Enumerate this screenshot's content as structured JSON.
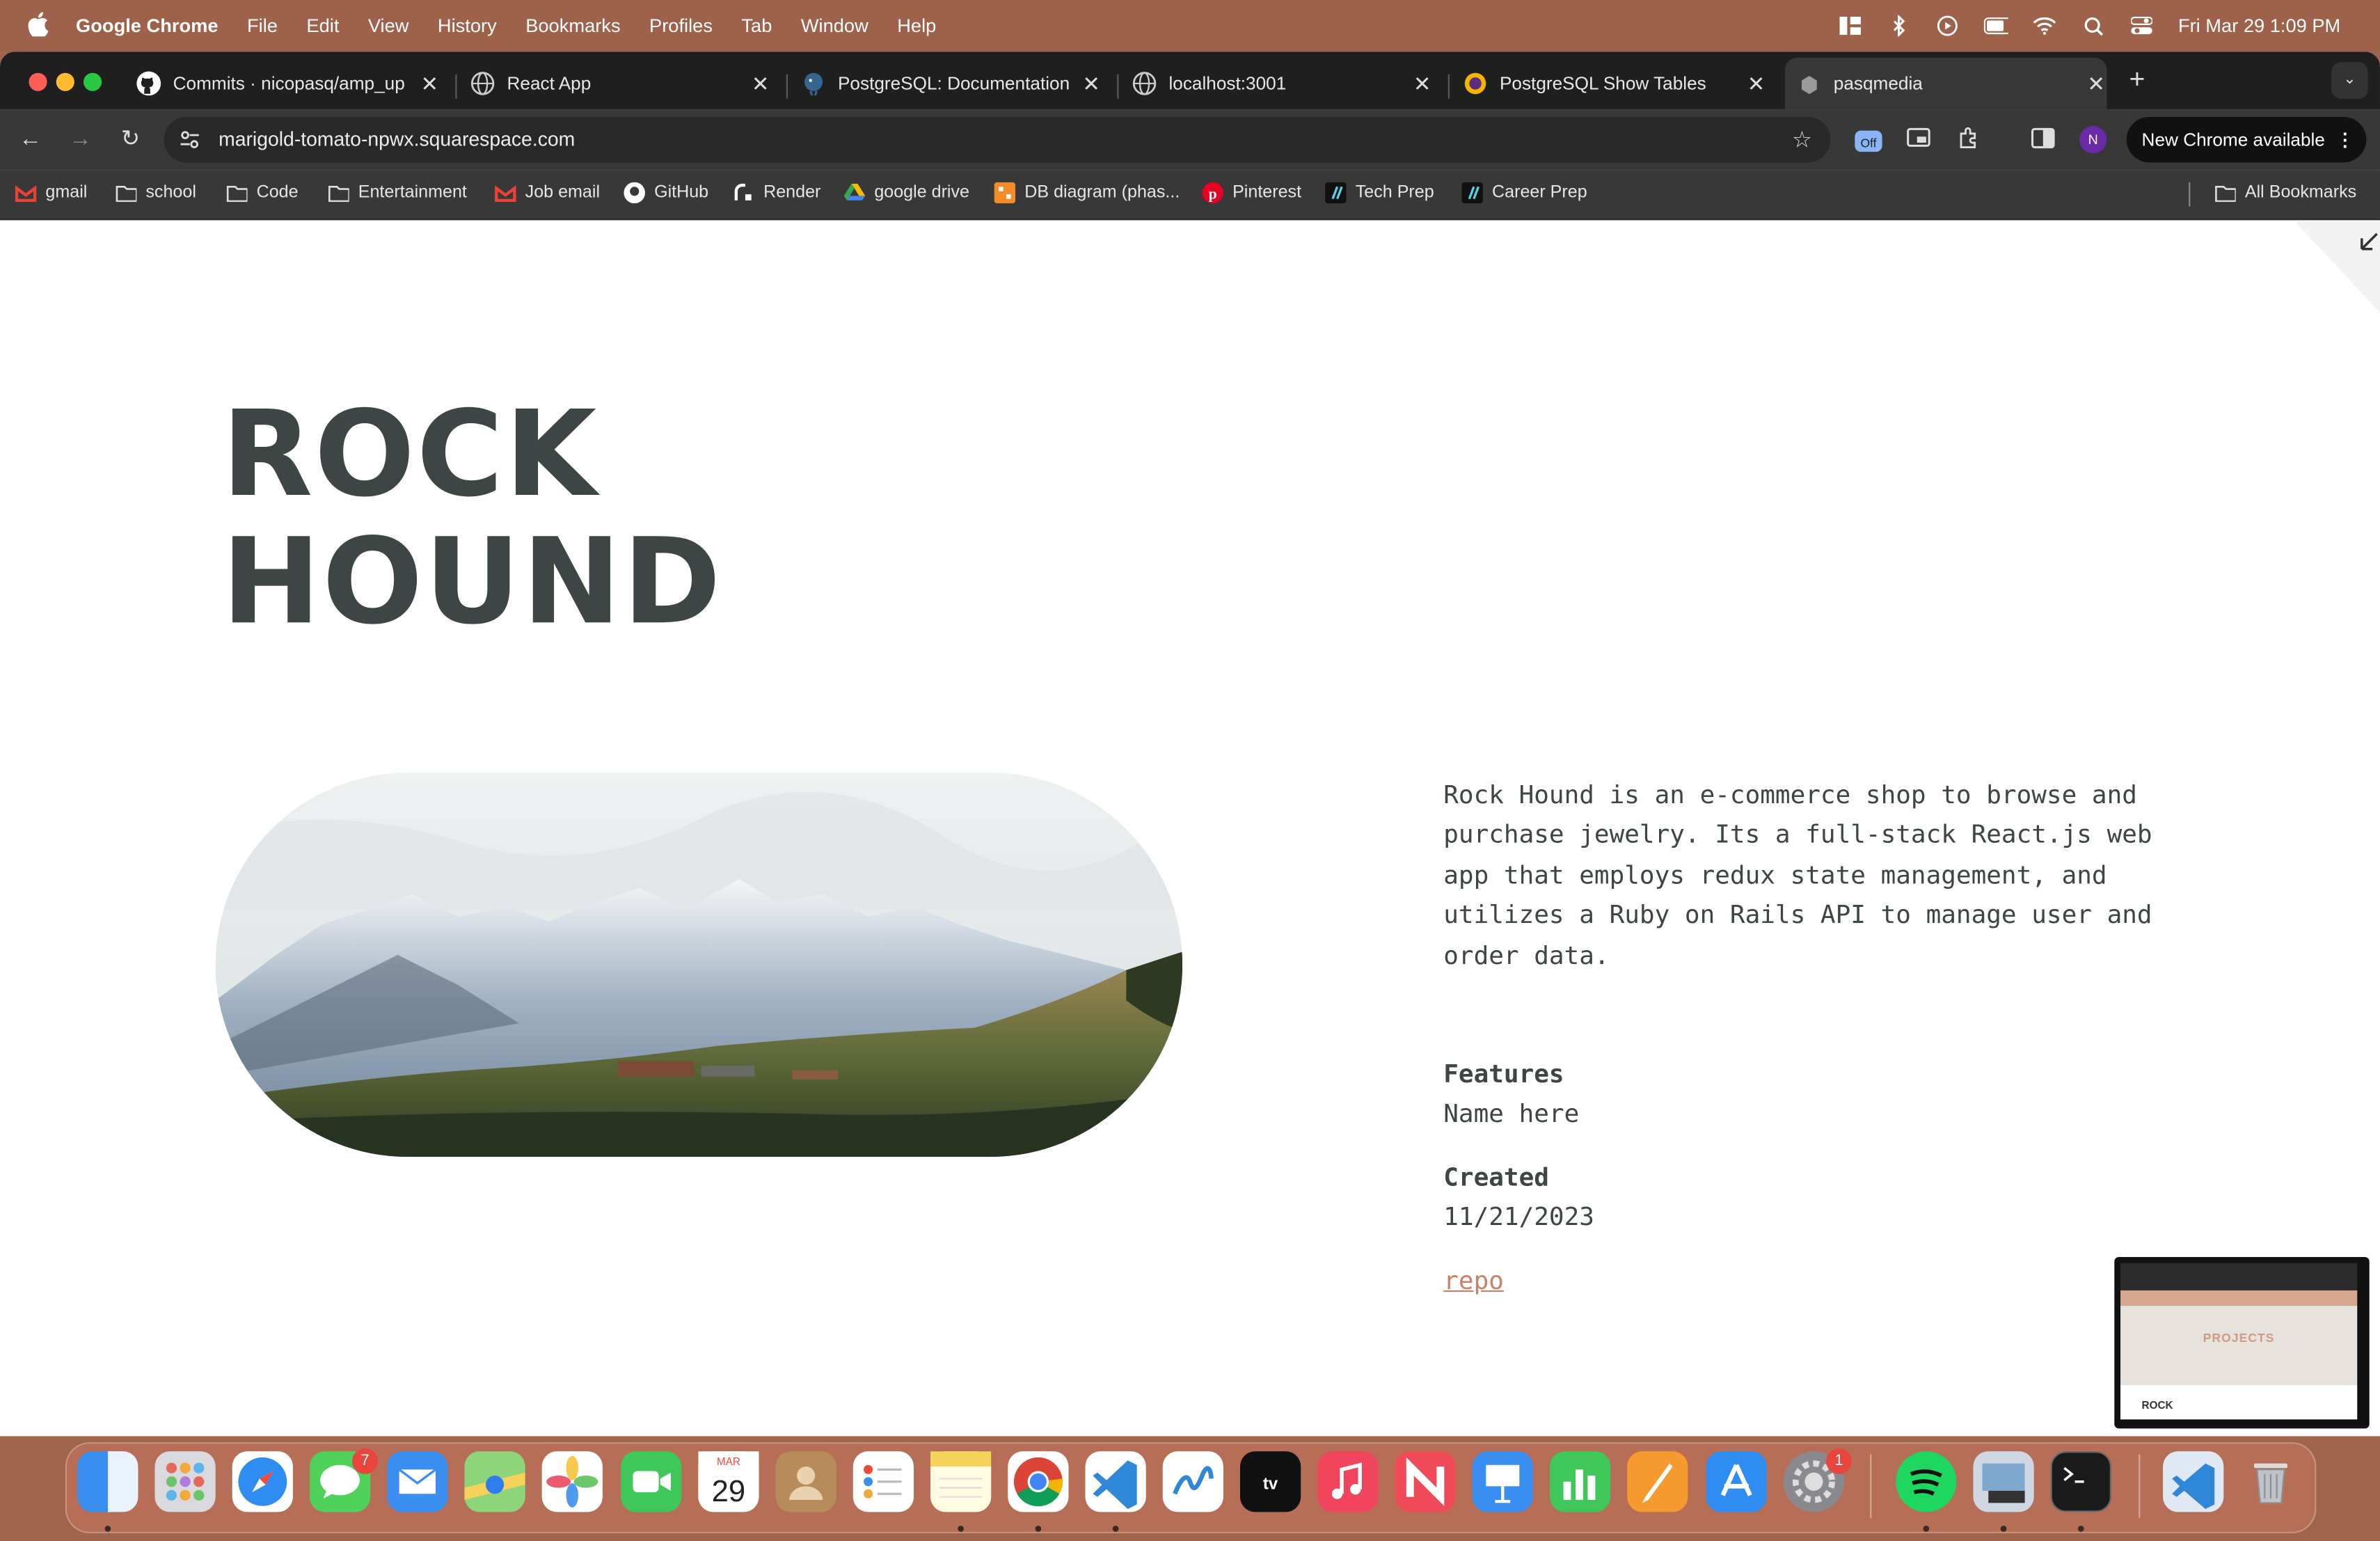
{
  "menubar": {
    "app": "Google Chrome",
    "menus": [
      "File",
      "Edit",
      "View",
      "History",
      "Bookmarks",
      "Profiles",
      "Tab",
      "Window",
      "Help"
    ],
    "clock": "Fri Mar 29  1:09 PM"
  },
  "tabs": [
    {
      "title": "Commits · nicopasq/amp_up",
      "active": false
    },
    {
      "title": "React App",
      "active": false
    },
    {
      "title": "PostgreSQL: Documentation",
      "active": false
    },
    {
      "title": "localhost:3001",
      "active": false
    },
    {
      "title": "PostgreSQL Show Tables",
      "active": false
    },
    {
      "title": "pasqmedia",
      "active": true
    }
  ],
  "toolbar": {
    "url": "marigold-tomato-npwx.squarespace.com",
    "extension_badge": "Off",
    "avatar_initial": "N",
    "update_label": "New Chrome available"
  },
  "bookmarks": {
    "items": [
      "gmail",
      "school",
      "Code",
      "Entertainment",
      "Job email",
      "GitHub",
      "Render",
      "google drive",
      "DB diagram (phas...",
      "Pinterest",
      "Tech Prep",
      "Career Prep"
    ],
    "all": "All Bookmarks"
  },
  "page": {
    "title_line1": "ROCK",
    "title_line2": "HOUND",
    "description": "Rock Hound is an e-commerce shop to browse and purchase jewelry. Its a full-stack React.js web app that employs redux state management, and utilizes a Ruby on Rails API to manage user and order data.",
    "features_label": "Features",
    "features_value": "Name here",
    "created_label": "Created",
    "created_value": "11/21/2023",
    "repo_link": "repo"
  },
  "thumbnail": {
    "label": "PROJECTS",
    "sub": "ROCK"
  },
  "dock": {
    "messages_badge": "7",
    "calendar_month": "MAR",
    "calendar_day": "29",
    "settings_badge": "1"
  }
}
